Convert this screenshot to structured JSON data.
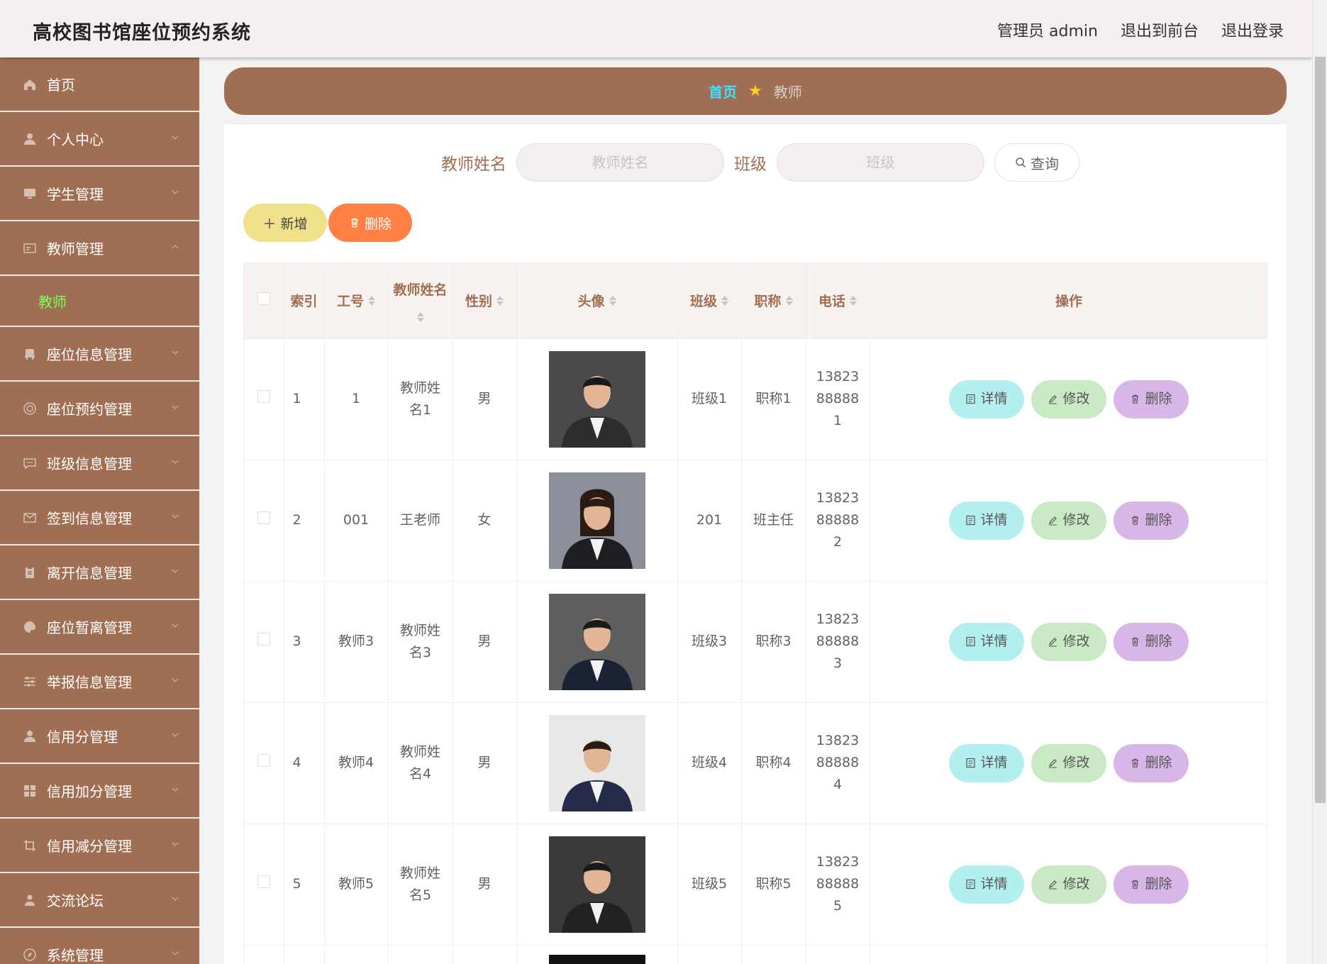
{
  "header": {
    "title": "高校图书馆座位预约系统",
    "admin_label": "管理员 admin",
    "to_front_label": "退出到前台",
    "logout_label": "退出登录"
  },
  "sidebar": {
    "items": [
      {
        "label": "首页",
        "icon": "home-icon"
      },
      {
        "label": "个人中心",
        "icon": "user-icon"
      },
      {
        "label": "学生管理",
        "icon": "monitor-icon"
      },
      {
        "label": "教师管理",
        "icon": "id-card-icon",
        "expanded": true,
        "children": [
          {
            "label": "教师",
            "active": true
          }
        ]
      },
      {
        "label": "座位信息管理",
        "icon": "chair-icon"
      },
      {
        "label": "座位预约管理",
        "icon": "target-icon"
      },
      {
        "label": "班级信息管理",
        "icon": "chat-icon"
      },
      {
        "label": "签到信息管理",
        "icon": "mail-icon"
      },
      {
        "label": "离开信息管理",
        "icon": "clipboard-icon"
      },
      {
        "label": "座位暂离管理",
        "icon": "palette-icon"
      },
      {
        "label": "举报信息管理",
        "icon": "sliders-icon"
      },
      {
        "label": "信用分管理",
        "icon": "person-icon"
      },
      {
        "label": "信用加分管理",
        "icon": "grid-icon"
      },
      {
        "label": "信用减分管理",
        "icon": "crop-icon"
      },
      {
        "label": "交流论坛",
        "icon": "forum-icon"
      },
      {
        "label": "系统管理",
        "icon": "compass-icon"
      }
    ]
  },
  "breadcrumb": {
    "home": "首页",
    "current": "教师"
  },
  "search": {
    "name_label": "教师姓名",
    "name_placeholder": "教师姓名",
    "class_label": "班级",
    "class_placeholder": "班级",
    "query_label": "查询"
  },
  "actions": {
    "add_label": "新增",
    "delete_label": "删除"
  },
  "table": {
    "columns": [
      "索引",
      "工号",
      "教师姓名",
      "性别",
      "头像",
      "班级",
      "职称",
      "电话",
      "操作"
    ],
    "rows": [
      {
        "index": "1",
        "id": "1",
        "name": "教师姓名1",
        "gender": "男",
        "class": "班级1",
        "title": "职称1",
        "phone": "13823888881"
      },
      {
        "index": "2",
        "id": "001",
        "name": "王老师",
        "gender": "女",
        "class": "201",
        "title": "班主任",
        "phone": "13823888882"
      },
      {
        "index": "3",
        "id": "教师3",
        "name": "教师姓名3",
        "gender": "男",
        "class": "班级3",
        "title": "职称3",
        "phone": "13823888883"
      },
      {
        "index": "4",
        "id": "教师4",
        "name": "教师姓名4",
        "gender": "男",
        "class": "班级4",
        "title": "职称4",
        "phone": "13823888884"
      },
      {
        "index": "5",
        "id": "教师5",
        "name": "教师姓名5",
        "gender": "男",
        "class": "班级5",
        "title": "职称5",
        "phone": "13823888885"
      }
    ],
    "op_detail": "详情",
    "op_edit": "修改",
    "op_delete": "删除"
  },
  "colors": {
    "sidebar_bg": "#a06f53",
    "header_bg": "#f5eeee",
    "active_submenu": "#7dff5a",
    "breadcrumb_home": "#3de0ff"
  }
}
